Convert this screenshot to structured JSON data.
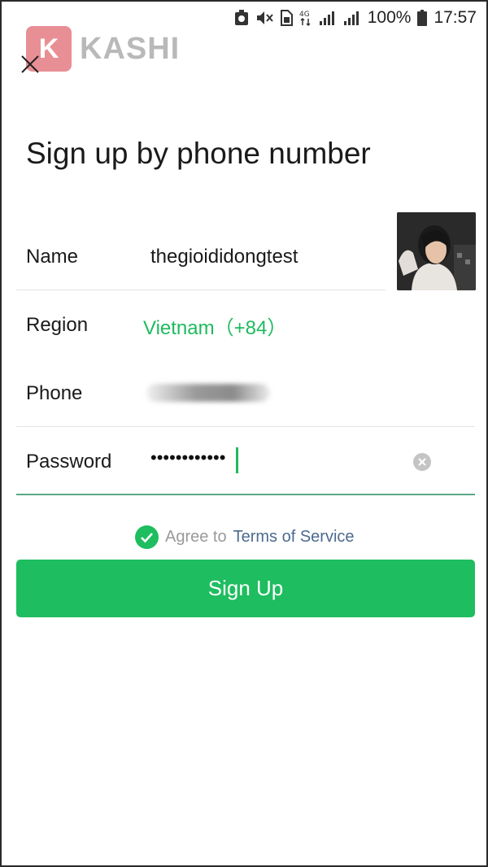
{
  "status_bar": {
    "icons": [
      "alarm-icon",
      "mute-icon",
      "sim-icon",
      "4g-icon",
      "signal-icon",
      "signal-icon",
      "battery-icon"
    ],
    "battery": "100%",
    "time": "17:57",
    "network": "4G"
  },
  "logo": {
    "badge": "K",
    "text": "KASHI",
    "badge_color": "#e88f95"
  },
  "header": {
    "close_icon": "close-icon",
    "title": "Sign up by phone number"
  },
  "form": {
    "name": {
      "label": "Name",
      "value": "thegioididongtest"
    },
    "region": {
      "label": "Region",
      "value": "Vietnam（+84）"
    },
    "phone": {
      "label": "Phone"
    },
    "password": {
      "label": "Password",
      "value": "••••••••••••"
    }
  },
  "agreement": {
    "text": "Agree to",
    "link": "Terms of Service"
  },
  "signup": {
    "label": "Sign Up",
    "color": "#1ebd5f"
  },
  "accent_green": "#1fba5e"
}
